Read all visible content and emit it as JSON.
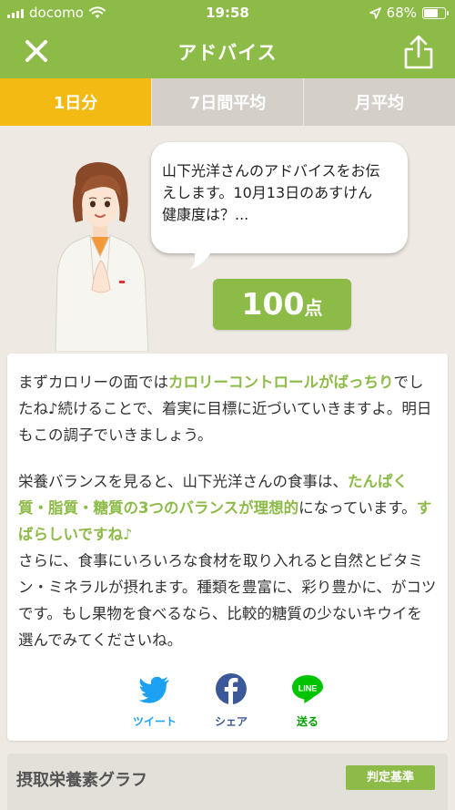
{
  "status_bar": {
    "carrier": "docomo",
    "time": "19:58",
    "battery": "68%",
    "battery_level": 0.68
  },
  "nav": {
    "title": "アドバイス",
    "close_icon": "close-icon",
    "share_icon": "share-icon"
  },
  "tabs": [
    {
      "label": "1日分",
      "active": true
    },
    {
      "label": "7日間平均",
      "active": false
    },
    {
      "label": "月平均",
      "active": false
    }
  ],
  "bubble": {
    "line1": "山下光洋さんのアドバイスをお伝",
    "line2": "えします。10月13日のあすけん",
    "line3": "健康度は？..."
  },
  "score": {
    "value": "100",
    "unit": "点"
  },
  "advice": {
    "p1_a": "まずカロリーの面では",
    "p1_hl": "カロリーコントロールがばっちり",
    "p1_b": "でしたね♪続けることで、着実に目標に近づいていきますよ。明日もこの調子でいきましょう。",
    "p2_a": "栄養バランスを見ると、山下光洋さんの食事は、",
    "p2_hl": "たんぱく質・脂質・糖質の3つのバランスが理想的",
    "p2_b": "になっています。",
    "p2_hl2": "すばらしいですね♪",
    "p3": "さらに、食事にいろいろな食材を取り入れると自然とビタミン・ミネラルが摂れます。種類を豊富に、彩り豊かに、がコツです。もし果物を食べるなら、比較的糖質の少ないキウイを選んでみてくださいね。"
  },
  "social": {
    "twitter": {
      "label": "ツイート",
      "color": "#1da1f2"
    },
    "facebook": {
      "label": "シェア",
      "color": "#3b5998"
    },
    "line": {
      "label": "送る",
      "color": "#00c300",
      "logo_text": "LINE"
    }
  },
  "graph": {
    "title": "摂取栄養素グラフ",
    "criteria_label": "判定基準"
  },
  "colors": {
    "accent_green": "#8dbb48",
    "tab_active": "#f3ba14",
    "tab_inactive": "#d4cfc8"
  }
}
